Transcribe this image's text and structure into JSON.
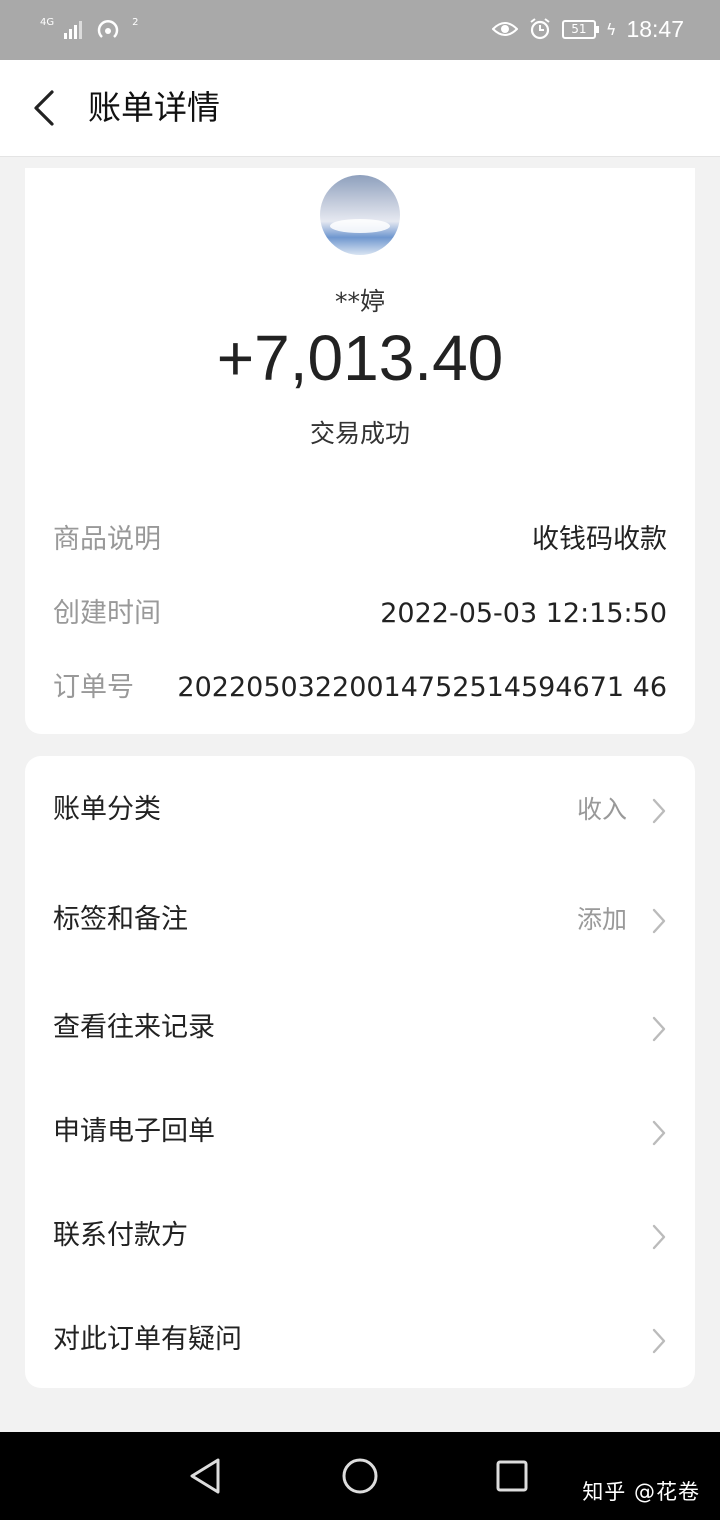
{
  "status_bar": {
    "network": "4G",
    "hotspot_count": "2",
    "battery": "51",
    "time": "18:47"
  },
  "nav": {
    "title": "账单详情"
  },
  "transaction": {
    "payer": "**婷",
    "amount": "+7,013.40",
    "status": "交易成功"
  },
  "details": {
    "product_label": "商品说明",
    "product_value": "收钱码收款",
    "time_label": "创建时间",
    "time_value": "2022-05-03 12:15:50",
    "order_label": "订单号",
    "order_value": "20220503220014752514594671 46"
  },
  "menu": [
    {
      "label": "账单分类",
      "value": "收入"
    },
    {
      "label": "标签和备注",
      "value": "添加"
    },
    {
      "label": "查看往来记录",
      "value": ""
    },
    {
      "label": "申请电子回单",
      "value": ""
    },
    {
      "label": "联系付款方",
      "value": ""
    },
    {
      "label": "对此订单有疑问",
      "value": ""
    }
  ],
  "watermark": "知乎 @花卷"
}
